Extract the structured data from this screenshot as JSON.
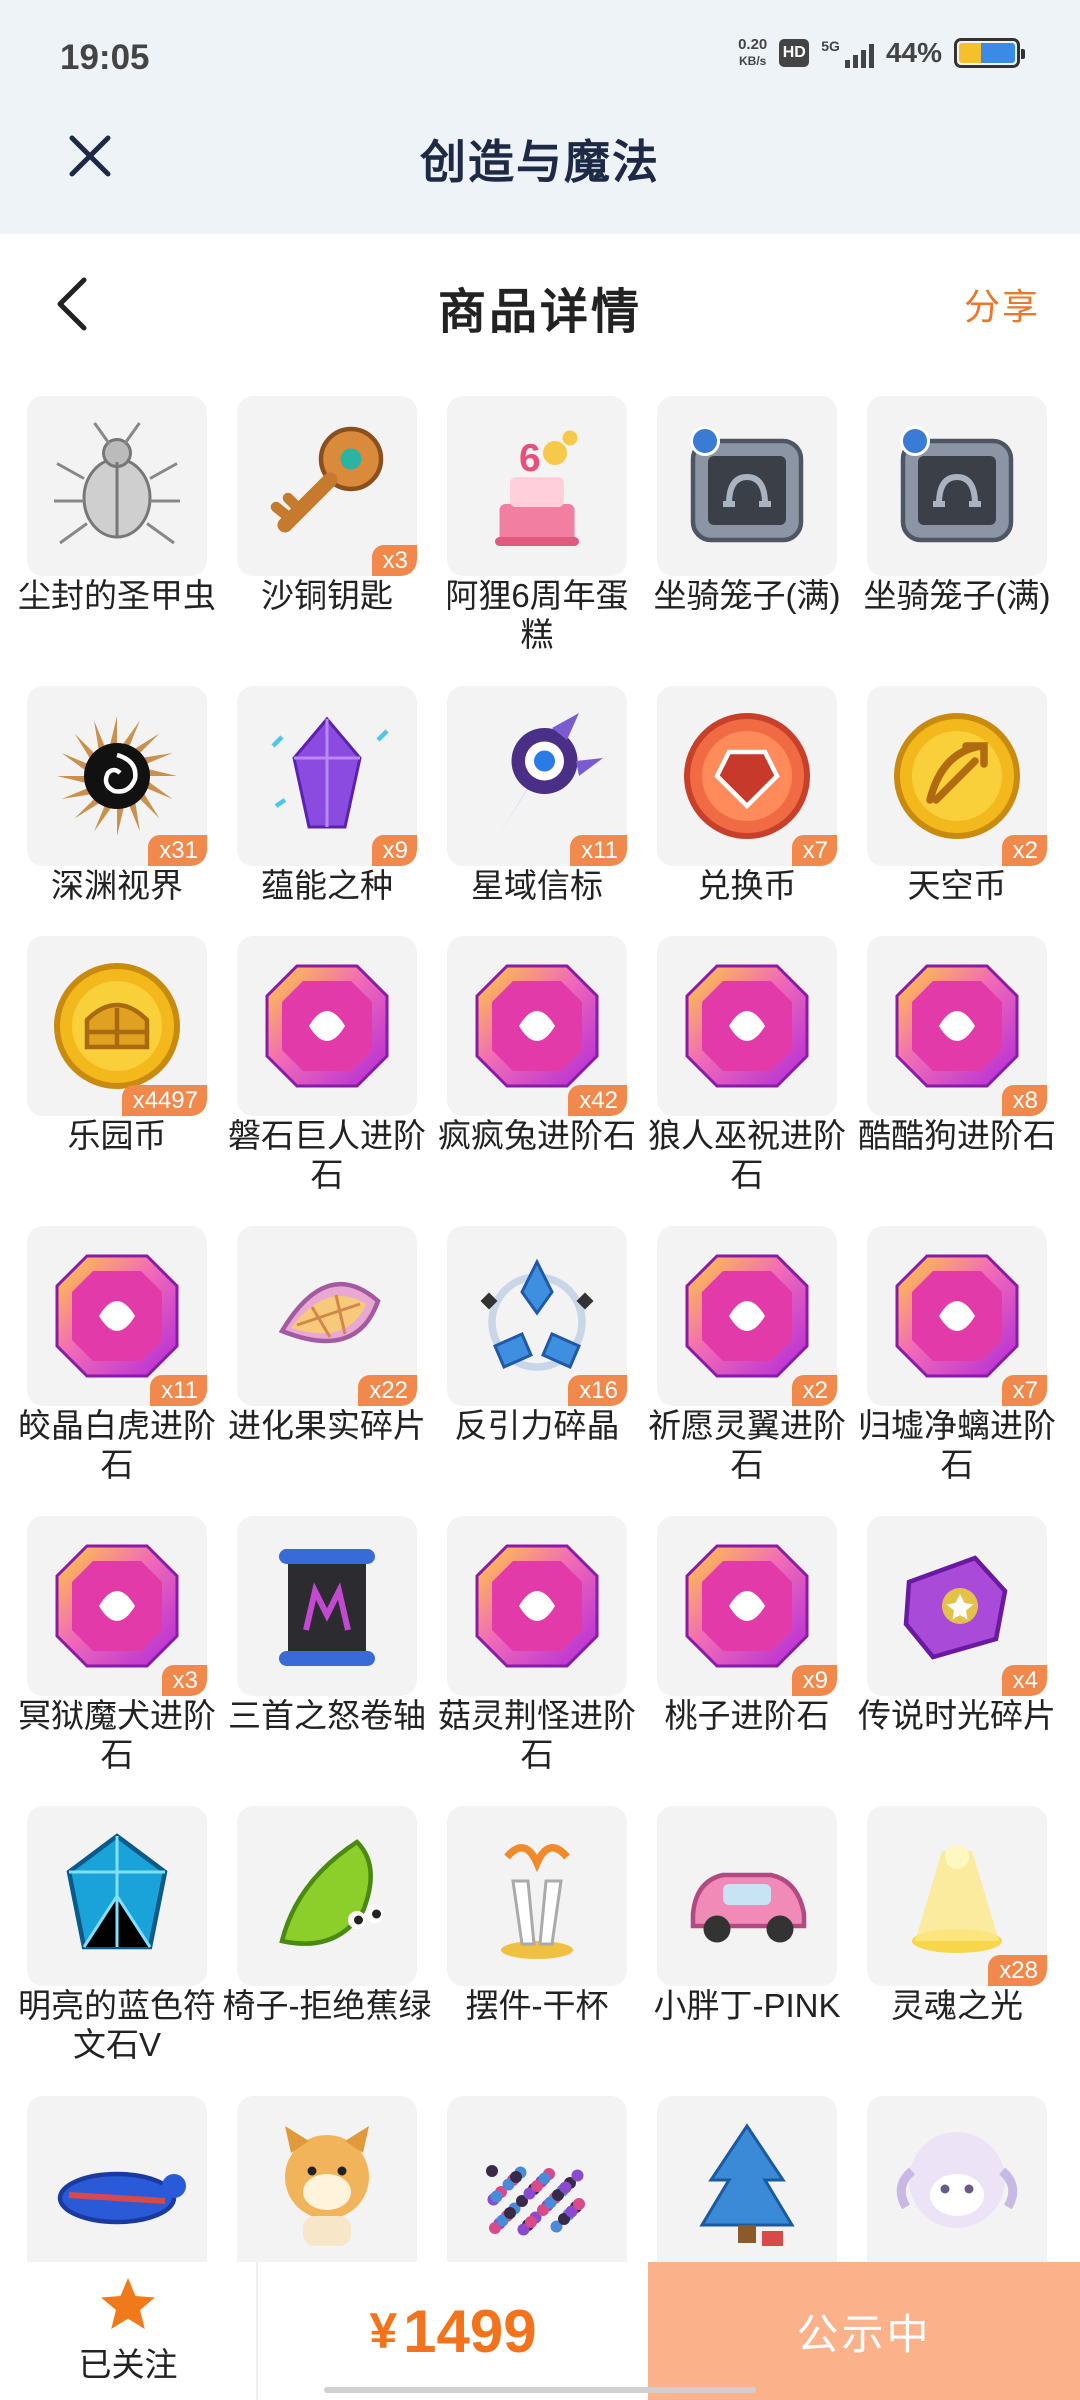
{
  "status_bar": {
    "time": "19:05",
    "net_speed_value": "0.20",
    "net_speed_unit": "KB/s",
    "hd_label": "HD",
    "signal_label": "5G",
    "battery_percent": "44%",
    "battery_level": 0.44
  },
  "app": {
    "title": "创造与魔法",
    "close_icon": "close-icon"
  },
  "page": {
    "title": "商品详情",
    "back_icon": "chevron-left-icon",
    "share_label": "分享"
  },
  "colors": {
    "accent_orange": "#e8782a",
    "price_orange": "#f2731c",
    "badge_orange": "#f0894b",
    "status_button": "#fbb28a",
    "title_navy": "#1e2a45"
  },
  "items": [
    {
      "name": "尘封的圣甲虫",
      "qty": "",
      "icon": "beetle"
    },
    {
      "name": "沙铜钥匙",
      "qty": "x3",
      "icon": "key"
    },
    {
      "name": "阿狸6周年蛋糕",
      "qty": "",
      "icon": "cake"
    },
    {
      "name": "坐骑笼子(满)",
      "qty": "",
      "icon": "cage"
    },
    {
      "name": "坐骑笼子(满)",
      "qty": "",
      "icon": "cage"
    },
    {
      "name": "深渊视界",
      "qty": "x31",
      "icon": "abyss"
    },
    {
      "name": "蕴能之种",
      "qty": "x9",
      "icon": "crystal"
    },
    {
      "name": "星域信标",
      "qty": "x11",
      "icon": "beacon"
    },
    {
      "name": "兑换币",
      "qty": "x7",
      "icon": "coin-red"
    },
    {
      "name": "天空币",
      "qty": "x2",
      "icon": "coin-sky"
    },
    {
      "name": "乐园币",
      "qty": "x4497",
      "icon": "coin-park"
    },
    {
      "name": "磐石巨人进阶石",
      "qty": "",
      "icon": "gem"
    },
    {
      "name": "疯疯兔进阶石",
      "qty": "x42",
      "icon": "gem"
    },
    {
      "name": "狼人巫祝进阶石",
      "qty": "",
      "icon": "gem"
    },
    {
      "name": "酷酷狗进阶石",
      "qty": "x8",
      "icon": "gem"
    },
    {
      "name": "皎晶白虎进阶石",
      "qty": "x11",
      "icon": "gem"
    },
    {
      "name": "进化果实碎片",
      "qty": "x22",
      "icon": "fruit"
    },
    {
      "name": "反引力碎晶",
      "qty": "x16",
      "icon": "antigravity"
    },
    {
      "name": "祈愿灵翼进阶石",
      "qty": "x2",
      "icon": "gem"
    },
    {
      "name": "归墟净螭进阶石",
      "qty": "x7",
      "icon": "gem"
    },
    {
      "name": "冥狱魔犬进阶石",
      "qty": "x3",
      "icon": "gem"
    },
    {
      "name": "三首之怒卷轴",
      "qty": "",
      "icon": "scroll"
    },
    {
      "name": "菇灵荆怪进阶石",
      "qty": "",
      "icon": "gem"
    },
    {
      "name": "桃子进阶石",
      "qty": "x9",
      "icon": "gem"
    },
    {
      "name": "传说时光碎片",
      "qty": "x4",
      "icon": "puzzle"
    },
    {
      "name": "明亮的蓝色符文石V",
      "qty": "",
      "icon": "runestone"
    },
    {
      "name": "椅子-拒绝蕉绿",
      "qty": "",
      "icon": "banana"
    },
    {
      "name": "摆件-干杯",
      "qty": "",
      "icon": "cheers"
    },
    {
      "name": "小胖丁-PINK",
      "qty": "",
      "icon": "car"
    },
    {
      "name": "灵魂之光",
      "qty": "x28",
      "icon": "light"
    },
    {
      "name": "",
      "qty": "",
      "icon": "turtle"
    },
    {
      "name": "",
      "qty": "",
      "icon": "dog"
    },
    {
      "name": "",
      "qty": "",
      "icon": "seeds"
    },
    {
      "name": "",
      "qty": "",
      "icon": "tree"
    },
    {
      "name": "",
      "qty": "",
      "icon": "sheep"
    }
  ],
  "bottom_bar": {
    "follow_label": "已关注",
    "follow_icon": "star-icon",
    "currency_symbol": "¥",
    "price": "1499",
    "status_label": "公示中"
  }
}
